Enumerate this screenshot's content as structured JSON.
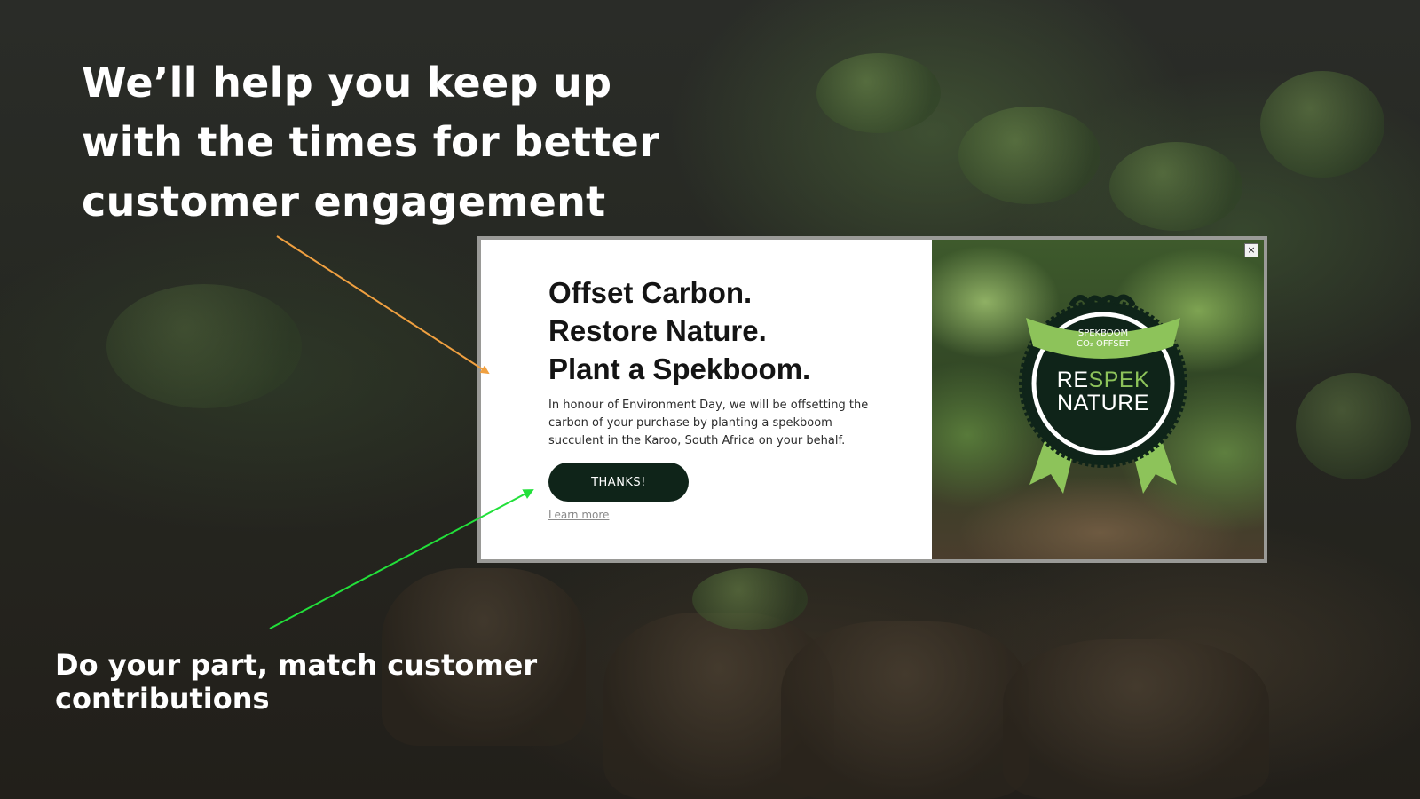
{
  "headline": {
    "line1": "We’ll help you keep up",
    "line2": "with the times for better",
    "line3": "customer engagement"
  },
  "caption": {
    "line1": "Do your part, match customer",
    "line2": "contributions"
  },
  "popup": {
    "title_line1": "Offset Carbon.",
    "title_line2": "Restore Nature.",
    "title_line3": "Plant a Spekboom.",
    "body": "In honour of Environment Day, we will be offsetting the carbon of your purchase by planting a spekboom succulent in the Karoo, South Africa on your behalf.",
    "button_label": "THANKS!",
    "link_label": "Learn more",
    "close_label": "×"
  },
  "badge": {
    "ribbon_line1": "SPEKBOOM",
    "ribbon_line2": "CO₂ OFFSET",
    "re": "RE",
    "spek": "SPEK",
    "nature": "NATURE"
  },
  "colors": {
    "button": "#0f2419",
    "orange_arrow": "#f0a040",
    "green_arrow": "#22e03a",
    "badge_green": "#8dc35a",
    "badge_dark": "#0f2419"
  }
}
